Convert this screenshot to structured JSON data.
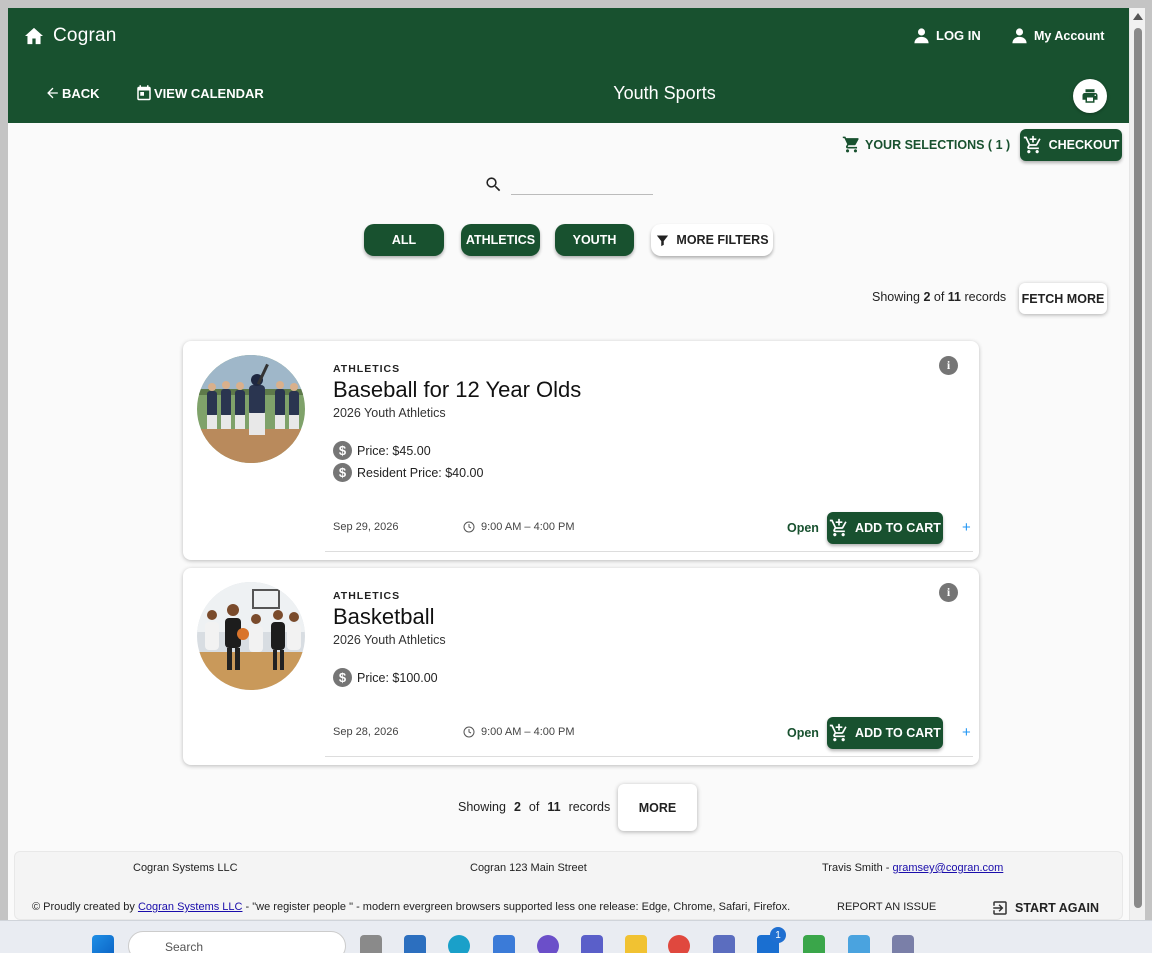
{
  "app": {
    "title": "Cogran",
    "page_title": "Youth Sports"
  },
  "header": {
    "login_label": "LOG IN",
    "account_label": "My Account",
    "back_label": "BACK",
    "calendar_label": "VIEW CALENDAR"
  },
  "cart": {
    "selections_label": "YOUR SELECTIONS ( 1 )",
    "checkout_label": "CHECKOUT"
  },
  "search": {
    "value": "",
    "placeholder": ""
  },
  "filters": [
    "ALL",
    "ATHLETICS",
    "YOUTH"
  ],
  "more_filters_label": "MORE FILTERS",
  "records": {
    "prefix": "Showing",
    "shown": "2",
    "of": "of",
    "total": "11",
    "suffix": "records",
    "fetch_more_label": "FETCH MORE",
    "more_label": "MORE"
  },
  "programs": [
    {
      "category": "ATHLETICS",
      "name": "Baseball for 12 Year Olds",
      "season": "2026 Youth Athletics",
      "prices": [
        "Price: $45.00",
        "Resident Price: $40.00"
      ],
      "date": "Sep 29, 2026",
      "time": "9:00 AM – 4:00 PM",
      "status": "Open",
      "cart_label": "ADD TO CART",
      "plus": "+"
    },
    {
      "category": "ATHLETICS",
      "name": "Basketball",
      "season": "2026 Youth Athletics",
      "prices": [
        "Price: $100.00"
      ],
      "date": "Sep 28, 2026",
      "time": "9:00 AM – 4:00 PM",
      "status": "Open",
      "cart_label": "ADD TO CART",
      "plus": "+"
    }
  ],
  "footer": {
    "company": "Cogran Systems LLC",
    "address": "Cogran 123 Main Street",
    "contact_name": "Travis Smith - ",
    "contact_email": "gramsey@cogran.com",
    "credit_prefix": "© Proudly created by ",
    "credit_link": "Cogran Systems LLC",
    "credit_suffix": " - \"we register people \" - modern evergreen browsers supported less one release: Edge, Chrome, Safari, Firefox.",
    "report_label": "REPORT AN ISSUE",
    "start_again_label": "START AGAIN"
  },
  "taskbar": {
    "search_placeholder": "Search",
    "mail_badge": "1"
  },
  "colors": {
    "primary": "#18512f",
    "accent": "#2196f3",
    "page_bg": "#fafafa"
  }
}
